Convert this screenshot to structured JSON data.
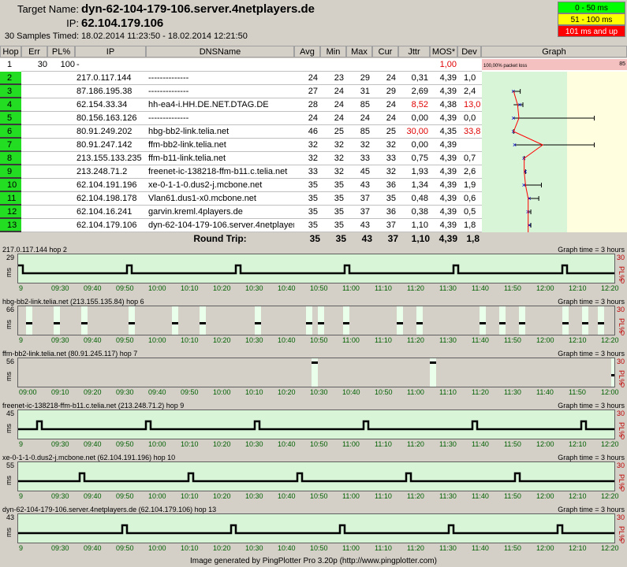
{
  "header": {
    "target_label": "Target Name:",
    "target_value": "dyn-62-104-179-106.server.4netplayers.de",
    "ip_label": "IP:",
    "ip_value": "62.104.179.106",
    "samples_label": "30 Samples Timed:",
    "samples_value": "18.02.2014 11:23:50 - 18.02.2014 12:21:50"
  },
  "legend": [
    {
      "label": "0 - 50 ms",
      "color": "#00ff00",
      "text": "#000000"
    },
    {
      "label": "51 - 100 ms",
      "color": "#ffff00",
      "text": "#000000"
    },
    {
      "label": "101 ms and up",
      "color": "#ff0000",
      "text": "#ffffff"
    }
  ],
  "columns": [
    "Hop",
    "Err",
    "PL%",
    "IP",
    "DNSName",
    "Avg",
    "Min",
    "Max",
    "Cur",
    "Jttr",
    "MOS*",
    "Dev",
    "Graph"
  ],
  "rows": [
    {
      "hop": "1",
      "err": "30",
      "pl": "100",
      "ip": "-",
      "dns": "",
      "avg": "",
      "min": "",
      "max": "",
      "cur": "",
      "jttr": "",
      "mos": "1,00",
      "dev": "",
      "mos_red": true,
      "green": false
    },
    {
      "hop": "2",
      "err": "",
      "pl": "",
      "ip": "217.0.117.144",
      "dns": "--------------",
      "avg": "24",
      "min": "23",
      "max": "29",
      "cur": "24",
      "jttr": "0,31",
      "mos": "4,39",
      "dev": "1,0",
      "green": true
    },
    {
      "hop": "3",
      "err": "",
      "pl": "",
      "ip": "87.186.195.38",
      "dns": "--------------",
      "avg": "27",
      "min": "24",
      "max": "31",
      "cur": "29",
      "jttr": "2,69",
      "mos": "4,39",
      "dev": "2,4",
      "green": true
    },
    {
      "hop": "4",
      "err": "",
      "pl": "",
      "ip": "62.154.33.34",
      "dns": "hh-ea4-i.HH.DE.NET.DTAG.DE",
      "avg": "28",
      "min": "24",
      "max": "85",
      "cur": "24",
      "jttr": "8,52",
      "mos": "4,38",
      "dev": "13,0",
      "jttr_red": true,
      "dev_red": true,
      "green": true
    },
    {
      "hop": "5",
      "err": "",
      "pl": "",
      "ip": "80.156.163.126",
      "dns": "--------------",
      "avg": "24",
      "min": "24",
      "max": "24",
      "cur": "24",
      "jttr": "0,00",
      "mos": "4,39",
      "dev": "0,0",
      "green": true
    },
    {
      "hop": "6",
      "err": "",
      "pl": "",
      "ip": "80.91.249.202",
      "dns": "hbg-bb2-link.telia.net",
      "avg": "46",
      "min": "25",
      "max": "85",
      "cur": "25",
      "jttr": "30,00",
      "mos": "4,35",
      "dev": "33,8",
      "jttr_red": true,
      "dev_red": true,
      "green": true
    },
    {
      "hop": "7",
      "err": "",
      "pl": "",
      "ip": "80.91.247.142",
      "dns": "ffm-bb2-link.telia.net",
      "avg": "32",
      "min": "32",
      "max": "32",
      "cur": "32",
      "jttr": "0,00",
      "mos": "4,39",
      "dev": "",
      "green": true
    },
    {
      "hop": "8",
      "err": "",
      "pl": "",
      "ip": "213.155.133.235",
      "dns": "ffm-b11-link.telia.net",
      "avg": "32",
      "min": "32",
      "max": "33",
      "cur": "33",
      "jttr": "0,75",
      "mos": "4,39",
      "dev": "0,7",
      "green": true
    },
    {
      "hop": "9",
      "err": "",
      "pl": "",
      "ip": "213.248.71.2",
      "dns": "freenet-ic-138218-ffm-b11.c.telia.net",
      "avg": "33",
      "min": "32",
      "max": "45",
      "cur": "32",
      "jttr": "1,93",
      "mos": "4,39",
      "dev": "2,6",
      "green": true
    },
    {
      "hop": "10",
      "err": "",
      "pl": "",
      "ip": "62.104.191.196",
      "dns": "xe-0-1-1-0.dus2-j.mcbone.net",
      "avg": "35",
      "min": "35",
      "max": "43",
      "cur": "36",
      "jttr": "1,34",
      "mos": "4,39",
      "dev": "1,9",
      "green": true
    },
    {
      "hop": "11",
      "err": "",
      "pl": "",
      "ip": "62.104.198.178",
      "dns": "Vlan61.dus1-x0.mcbone.net",
      "avg": "35",
      "min": "35",
      "max": "37",
      "cur": "35",
      "jttr": "0,48",
      "mos": "4,39",
      "dev": "0,6",
      "green": true
    },
    {
      "hop": "12",
      "err": "",
      "pl": "",
      "ip": "62.104.16.241",
      "dns": "garvin.kreml.4players.de",
      "avg": "35",
      "min": "35",
      "max": "37",
      "cur": "36",
      "jttr": "0,38",
      "mos": "4,39",
      "dev": "0,5",
      "green": true
    },
    {
      "hop": "13",
      "err": "",
      "pl": "",
      "ip": "62.104.179.106",
      "dns": "dyn-62-104-179-106.server.4netplayers.de",
      "avg": "35",
      "min": "35",
      "max": "43",
      "cur": "37",
      "jttr": "1,10",
      "mos": "4,39",
      "dev": "1,8",
      "green": true
    }
  ],
  "graph_label": "100,00% packet loss",
  "graph_scale_max": "85",
  "roundtrip": {
    "label": "Round Trip:",
    "avg": "35",
    "min": "35",
    "max": "43",
    "cur": "37",
    "jttr": "1,10",
    "mos": "4,39",
    "dev": "1,8"
  },
  "panels": [
    {
      "title": "217.0.117.144 hop 2",
      "max": "29",
      "ms": "ms",
      "pl_max": "30",
      "pl_label": "PL%",
      "pl_min": "0",
      "graph_time": "Graph time = 3 hours",
      "ticks": [
        "9",
        "09:30",
        "09:40",
        "09:50",
        "10:00",
        "10:10",
        "10:20",
        "10:30",
        "10:40",
        "10:50",
        "11:00",
        "11:10",
        "11:20",
        "11:30",
        "11:40",
        "11:50",
        "12:00",
        "12:10",
        "12:20"
      ]
    },
    {
      "title": "hbg-bb2-link.telia.net (213.155.135.84) hop 6",
      "max": "66",
      "ms": "ms",
      "pl_max": "30",
      "pl_label": "PL%",
      "pl_min": "0",
      "graph_time": "Graph time = 3 hours",
      "ticks": [
        "9",
        "09:30",
        "09:40",
        "09:50",
        "10:00",
        "10:10",
        "10:20",
        "10:30",
        "10:40",
        "10:50",
        "11:00",
        "11:10",
        "11:20",
        "11:30",
        "11:40",
        "11:50",
        "12:00",
        "12:10",
        "12:20"
      ]
    },
    {
      "title": "ffm-bb2-link.telia.net (80.91.245.117) hop 7",
      "max": "56",
      "ms": "ms",
      "pl_max": "30",
      "pl_label": "PL%",
      "pl_min": "0",
      "graph_time": "Graph time = 3 hours",
      "ticks": [
        "09:00",
        "09:10",
        "09:20",
        "09:30",
        "09:40",
        "09:50",
        "10:00",
        "10:10",
        "10:20",
        "10:30",
        "10:40",
        "10:50",
        "11:00",
        "11:10",
        "11:20",
        "11:30",
        "11:40",
        "11:50",
        "12:00"
      ]
    },
    {
      "title": "freenet-ic-138218-ffm-b11.c.telia.net (213.248.71.2) hop 9",
      "max": "45",
      "ms": "ms",
      "pl_max": "30",
      "pl_label": "PL%",
      "pl_min": "0",
      "graph_time": "Graph time = 3 hours",
      "ticks": [
        "9",
        "09:30",
        "09:40",
        "09:50",
        "10:00",
        "10:10",
        "10:20",
        "10:30",
        "10:40",
        "10:50",
        "11:00",
        "11:10",
        "11:20",
        "11:30",
        "11:40",
        "11:50",
        "12:00",
        "12:10",
        "12:20"
      ]
    },
    {
      "title": "xe-0-1-1-0.dus2-j.mcbone.net (62.104.191.196) hop 10",
      "max": "55",
      "ms": "ms",
      "pl_max": "30",
      "pl_label": "PL%",
      "pl_min": "0",
      "graph_time": "Graph time = 3 hours",
      "ticks": [
        "9",
        "09:30",
        "09:40",
        "09:50",
        "10:00",
        "10:10",
        "10:20",
        "10:30",
        "10:40",
        "10:50",
        "11:00",
        "11:10",
        "11:20",
        "11:30",
        "11:40",
        "11:50",
        "12:00",
        "12:10",
        "12:20"
      ]
    },
    {
      "title": "dyn-62-104-179-106.server.4netplayers.de (62.104.179.106) hop 13",
      "max": "43",
      "ms": "ms",
      "pl_max": "30",
      "pl_label": "PL%",
      "pl_min": "0",
      "graph_time": "Graph time = 3 hours",
      "ticks": [
        "9",
        "09:30",
        "09:40",
        "09:50",
        "10:00",
        "10:10",
        "10:20",
        "10:30",
        "10:40",
        "10:50",
        "11:00",
        "11:10",
        "11:20",
        "11:30",
        "11:40",
        "11:50",
        "12:00",
        "12:10",
        "12:20"
      ]
    }
  ],
  "footer": "Image generated by PingPlotter Pro 3.20p (http://www.pingplotter.com)"
}
